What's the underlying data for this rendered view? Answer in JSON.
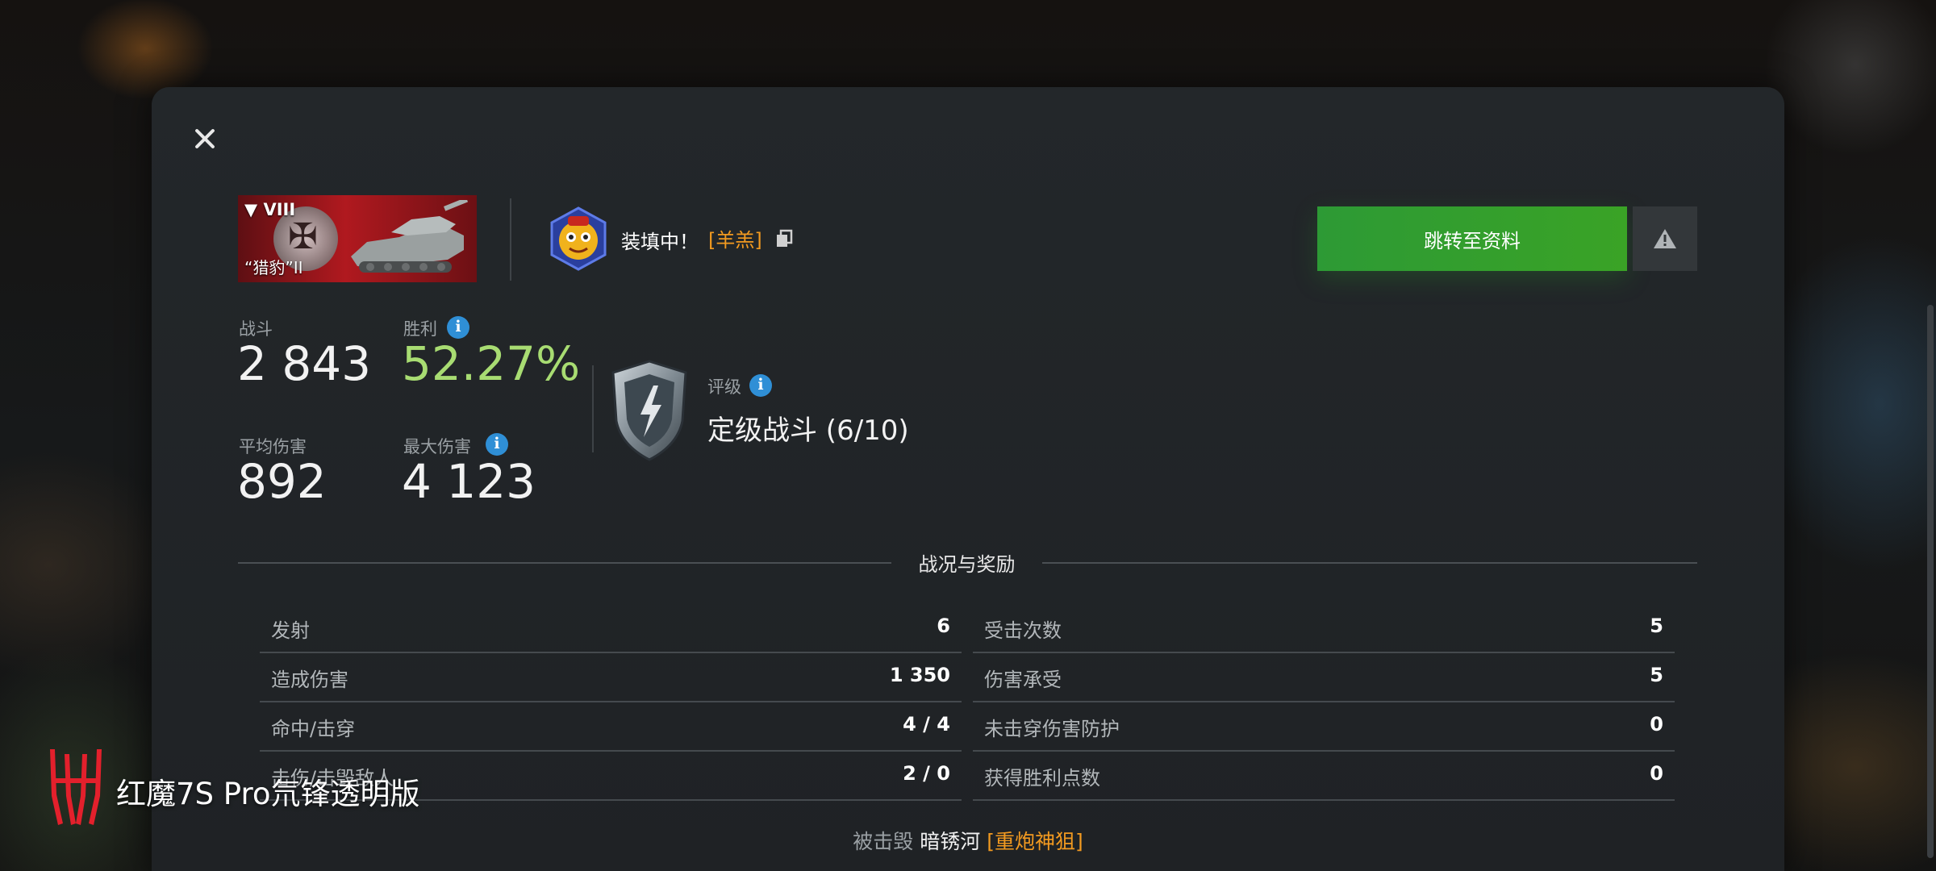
{
  "tank": {
    "tier": "▼ VIII",
    "name": "“猎豹”II"
  },
  "player": {
    "name": "装填中！",
    "clan": "[羊羔]"
  },
  "actions": {
    "profile_button": "跳转至资料"
  },
  "stats": {
    "battles_label": "战斗",
    "battles_value": "2 843",
    "winrate_label": "胜利",
    "winrate_value": "52.27%",
    "avg_damage_label": "平均伤害",
    "avg_damage_value": "892",
    "max_damage_label": "最大伤害",
    "max_damage_value": "4 123"
  },
  "rating": {
    "label": "评级",
    "value": "定级战斗 (6/10)"
  },
  "section": {
    "title": "战况与奖励"
  },
  "battle_stats": {
    "left": [
      {
        "label": "发射",
        "value": "6"
      },
      {
        "label": "造成伤害",
        "value": "1 350"
      },
      {
        "label": "命中/击穿",
        "value": "4 / 4"
      },
      {
        "label": "击伤/击毁敌人",
        "value": "2 / 0"
      }
    ],
    "right": [
      {
        "label": "受击次数",
        "value": "5"
      },
      {
        "label": "伤害承受",
        "value": "5"
      },
      {
        "label": "未击穿伤害防护",
        "value": "0"
      },
      {
        "label": "获得胜利点数",
        "value": "0"
      }
    ]
  },
  "killed_by": {
    "label": "被击毁",
    "name": "暗锈河",
    "clan": "[重炮神狙]"
  },
  "watermark": {
    "text": "红魔7S Pro氘锋透明版"
  },
  "colors": {
    "accent_green": "#2d9a35",
    "winrate_green": "#a8dc72",
    "clan_orange": "#f29a20",
    "info_blue": "#2f8fd6",
    "banner_red": "#b0191f"
  },
  "icons": [
    "close-icon",
    "copy-icon",
    "warning-icon",
    "info-icon",
    "rating-shield-icon",
    "player-avatar-icon",
    "nation-emblem-icon",
    "redmagic-logo-icon"
  ]
}
